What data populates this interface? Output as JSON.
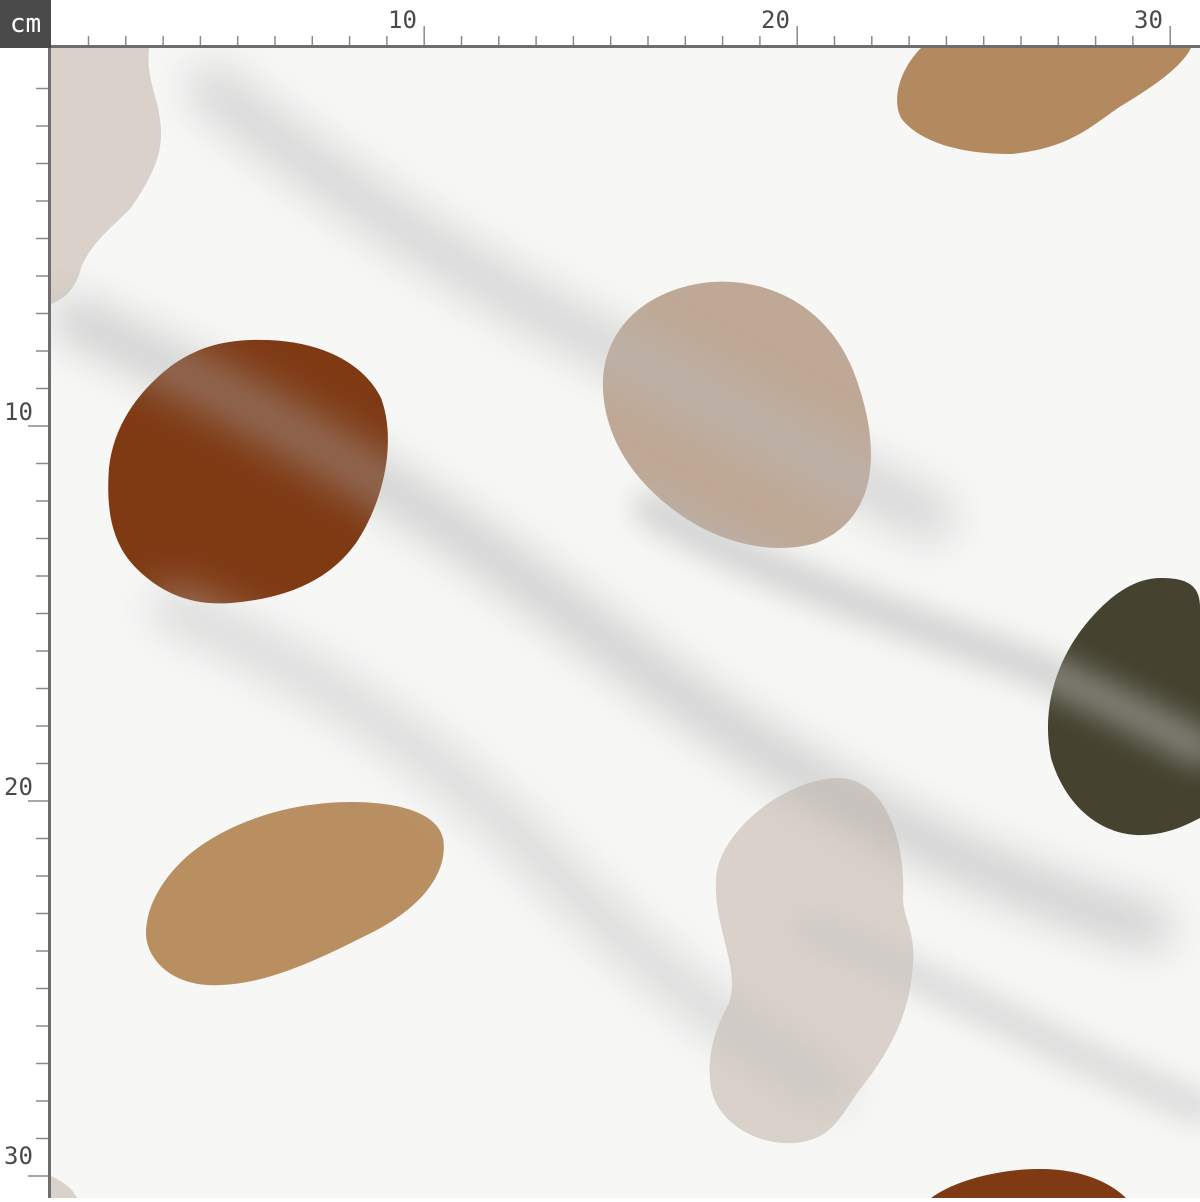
{
  "ruler": {
    "unit": "cm",
    "top_labels": [
      "10",
      "20",
      "30"
    ],
    "left_labels": [
      "10",
      "20",
      "30"
    ]
  },
  "swatch": {
    "background_color": "#f7f7f6",
    "shadow_color": "#c9c9c9",
    "spot_colors": {
      "rust": "#7f3a14",
      "camel": "#b98f62",
      "taupe": "#bfa996",
      "olive": "#45432f",
      "greige": "#dad2ca"
    }
  }
}
